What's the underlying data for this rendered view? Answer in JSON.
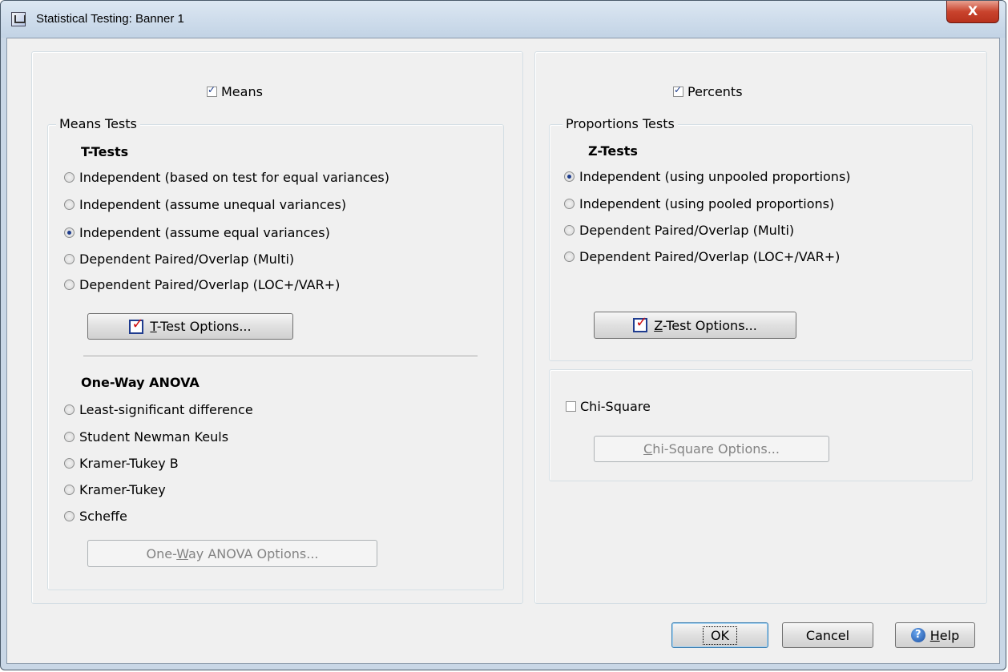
{
  "window": {
    "title": "Statistical Testing: Banner 1",
    "close_glyph": "X"
  },
  "left": {
    "means_checkbox": {
      "label": "Means",
      "checked": true
    },
    "means_tests": {
      "legend": "Means Tests",
      "t_tests": {
        "heading": "T-Tests",
        "options": [
          {
            "label": "Independent (based on test for equal variances)",
            "selected": false
          },
          {
            "label": "Independent (assume unequal variances)",
            "selected": false
          },
          {
            "label": "Independent (assume equal variances)",
            "selected": true
          },
          {
            "label": "Dependent Paired/Overlap (Multi)",
            "selected": false
          },
          {
            "label": "Dependent Paired/Overlap (LOC+/VAR+)",
            "selected": false
          }
        ],
        "options_button": {
          "mnemonic": "T",
          "rest": "-Test Options..."
        }
      },
      "anova": {
        "heading": "One-Way ANOVA",
        "options": [
          {
            "label": "Least-significant difference",
            "selected": false
          },
          {
            "label": "Student Newman Keuls",
            "selected": false
          },
          {
            "label": "Kramer-Tukey B",
            "selected": false
          },
          {
            "label": "Kramer-Tukey",
            "selected": false
          },
          {
            "label": "Scheffe",
            "selected": false
          }
        ],
        "options_button": {
          "pre": "One-",
          "mnemonic": "W",
          "rest": "ay ANOVA Options..."
        }
      }
    }
  },
  "right": {
    "percents_checkbox": {
      "label": "Percents",
      "checked": true
    },
    "proportions_tests": {
      "legend": "Proportions Tests",
      "z_tests": {
        "heading": "Z-Tests",
        "options": [
          {
            "label": "Independent (using unpooled proportions)",
            "selected": true
          },
          {
            "label": "Independent (using pooled proportions)",
            "selected": false
          },
          {
            "label": "Dependent Paired/Overlap (Multi)",
            "selected": false
          },
          {
            "label": "Dependent Paired/Overlap (LOC+/VAR+)",
            "selected": false
          }
        ],
        "options_button": {
          "mnemonic": "Z",
          "rest": "-Test Options..."
        }
      }
    },
    "chi_square": {
      "checkbox": {
        "label": "Chi-Square",
        "checked": false
      },
      "options_button": {
        "mnemonic": "C",
        "rest": "hi-Square Options..."
      }
    }
  },
  "footer": {
    "ok_label": "OK",
    "cancel_label": "Cancel",
    "help": {
      "mnemonic": "H",
      "rest": "elp",
      "icon": "help-icon"
    }
  },
  "colors": {
    "accent": "#1d3c8c",
    "check_red": "#d01010",
    "close_red": "#c9432d"
  }
}
